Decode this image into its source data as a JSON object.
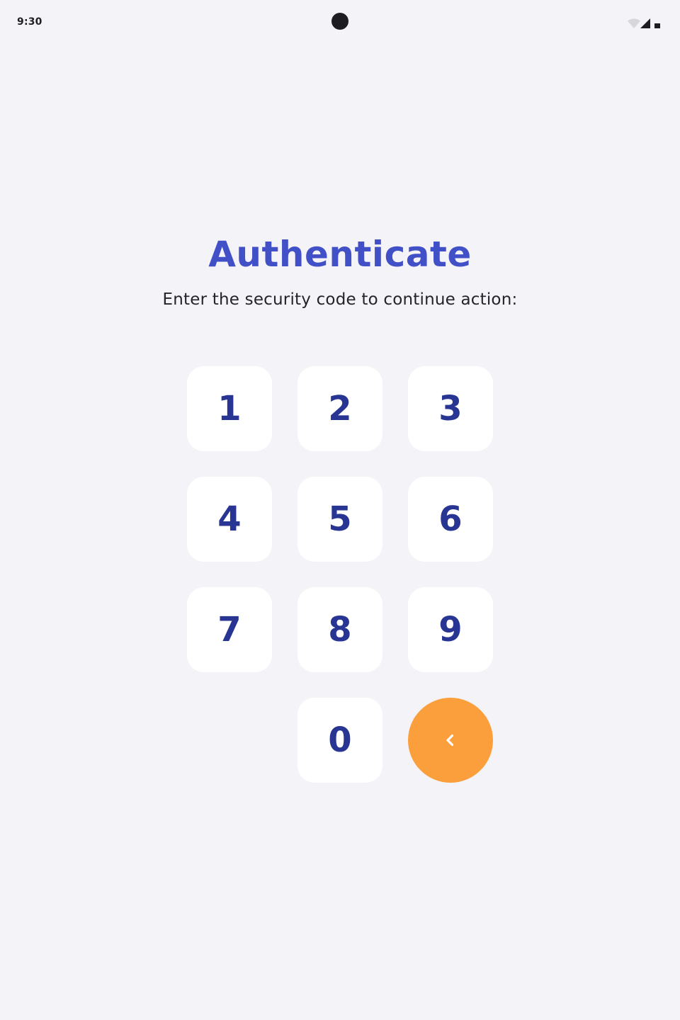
{
  "status_bar": {
    "time": "9:30",
    "icons": [
      "wifi-icon",
      "signal-icon",
      "battery-icon"
    ]
  },
  "screen": {
    "title": "Authenticate",
    "subtitle": "Enter the security code to continue action:"
  },
  "keypad": {
    "keys": [
      "1",
      "2",
      "3",
      "4",
      "5",
      "6",
      "7",
      "8",
      "9",
      "0"
    ],
    "backspace_icon": "chevron-left-icon"
  },
  "colors": {
    "background": "#f4f4f8",
    "title": "#4250c8",
    "key_text": "#283593",
    "key_background": "#ffffff",
    "backspace_background": "#fb9f3c"
  }
}
